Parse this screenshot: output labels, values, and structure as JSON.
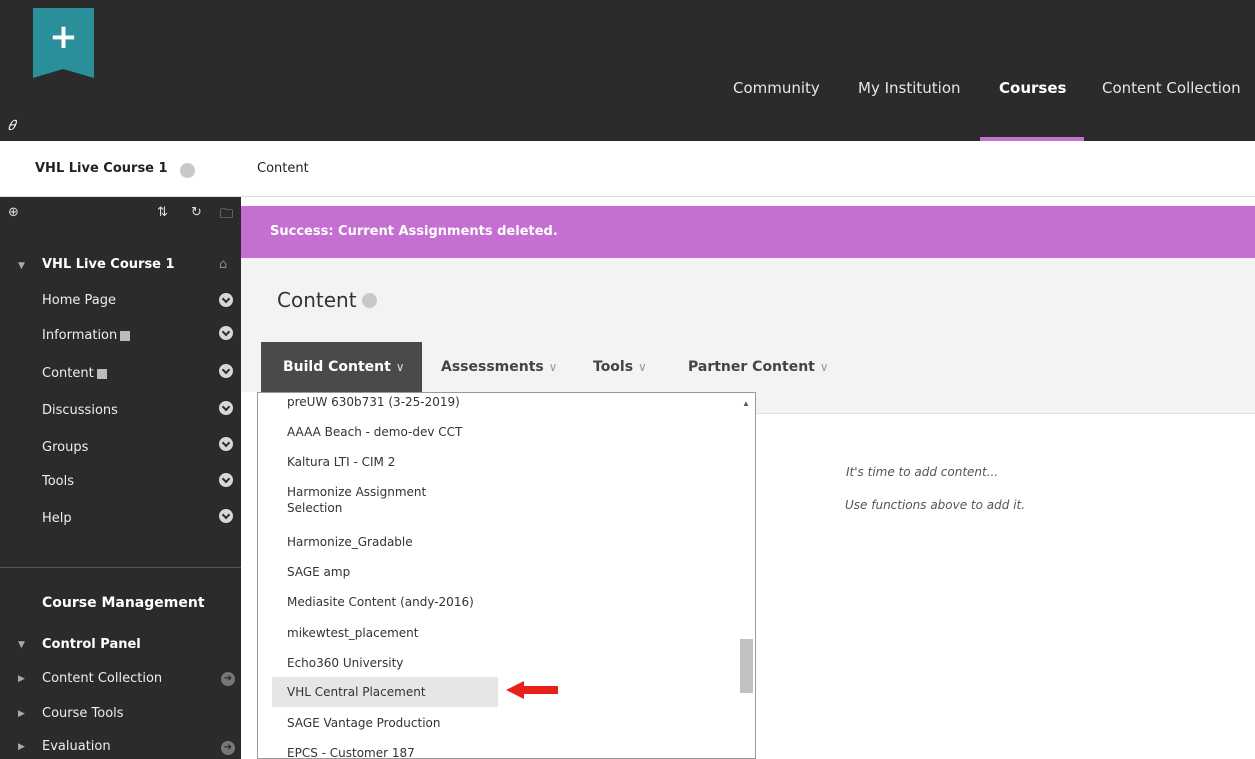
{
  "header": {
    "logo_glyph": "+",
    "link_glyph": "⚲",
    "tabs": [
      {
        "label": "Community",
        "active": false
      },
      {
        "label": "My Institution",
        "active": false
      },
      {
        "label": "Courses",
        "active": true
      },
      {
        "label": "Content Collection",
        "active": false
      }
    ],
    "accent_color": "#c46fd1"
  },
  "breadcrumb": {
    "course": "VHL Live Course 1",
    "page": "Content"
  },
  "sidebar": {
    "tools": [
      "⊕",
      "⇅",
      "↻",
      "🗀"
    ],
    "course_title": "VHL Live Course 1",
    "items": [
      {
        "label": "Home Page"
      },
      {
        "label": "Information"
      },
      {
        "label": "Content"
      },
      {
        "label": "Discussions"
      },
      {
        "label": "Groups"
      },
      {
        "label": "Tools"
      },
      {
        "label": "Help"
      }
    ],
    "management_title": "Course Management",
    "control_panel": "Control Panel",
    "cp_items": [
      {
        "label": "Content Collection"
      },
      {
        "label": "Course Tools"
      },
      {
        "label": "Evaluation"
      }
    ]
  },
  "main": {
    "success_message": "Success: Current Assignments deleted.",
    "page_title": "Content",
    "actions": {
      "build": "Build Content",
      "assessments": "Assessments",
      "tools": "Tools",
      "partner": "Partner Content",
      "caret": "∨"
    },
    "empty_line1": "It's time to add content...",
    "empty_line2": "Use functions above to add it."
  },
  "dropdown": {
    "items": [
      "preUW 630b731 (3-25-2019)",
      "AAAA Beach - demo-dev CCT",
      "Kaltura LTI - CIM 2",
      "Harmonize Assignment Selection",
      "Harmonize_Gradable",
      "SAGE amp",
      "Mediasite Content (andy-2016)",
      "mikewtest_placement",
      "Echo360 University",
      "VHL Central Placement",
      "SAGE Vantage Production",
      "EPCS - Customer 187"
    ],
    "highlighted_index": 9
  }
}
